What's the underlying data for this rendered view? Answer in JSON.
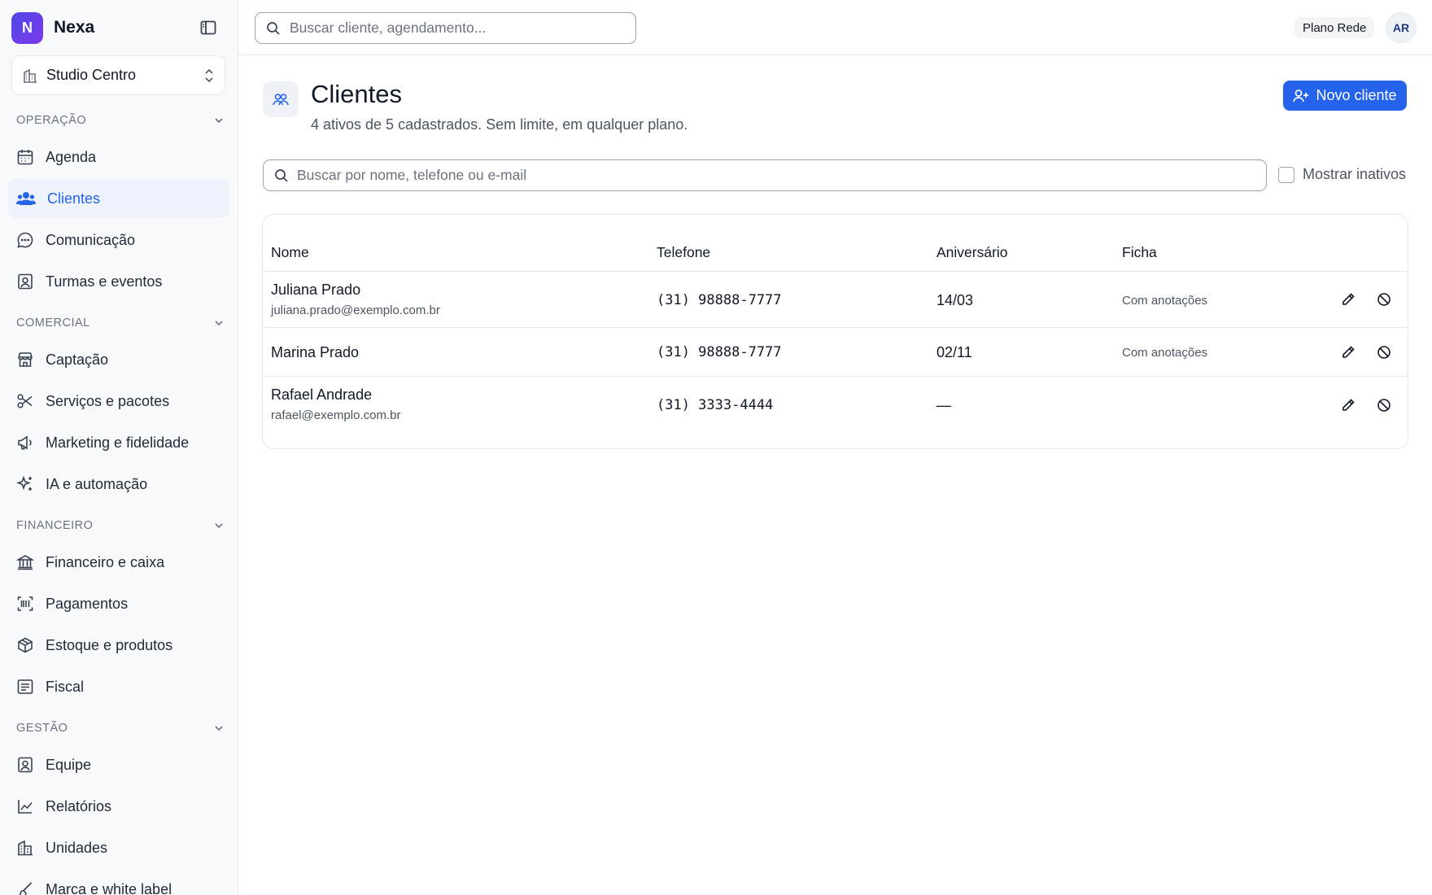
{
  "brand": {
    "logo_letter": "N",
    "name": "Nexa"
  },
  "unit_selector": {
    "label": "Studio Centro"
  },
  "sections": {
    "operacao": "OPERAÇÃO",
    "comercial": "COMERCIAL",
    "financeiro": "FINANCEIRO",
    "gestao": "GESTÃO"
  },
  "nav": {
    "agenda": "Agenda",
    "clientes": "Clientes",
    "comunicacao": "Comunicação",
    "turmas": "Turmas e eventos",
    "captacao": "Captação",
    "servicos": "Serviços e pacotes",
    "marketing": "Marketing e fidelidade",
    "ia": "IA e automação",
    "financeiro": "Financeiro e caixa",
    "pagamentos": "Pagamentos",
    "estoque": "Estoque e produtos",
    "fiscal": "Fiscal",
    "equipe": "Equipe",
    "relatorios": "Relatórios",
    "unidades": "Unidades",
    "marca": "Marca e white label"
  },
  "topbar": {
    "search_placeholder": "Buscar cliente, agendamento...",
    "plan": "Plano Rede",
    "avatar_initials": "AR"
  },
  "page": {
    "title": "Clientes",
    "subtitle": "4 ativos de 5 cadastrados. Sem limite, em qualquer plano.",
    "new_button": "Novo cliente",
    "filter_placeholder": "Buscar por nome, telefone ou e-mail",
    "show_inactive_label": "Mostrar inativos"
  },
  "table": {
    "headers": {
      "name": "Nome",
      "phone": "Telefone",
      "birthday": "Aniversário",
      "record": "Ficha"
    },
    "rows": [
      {
        "name": "Juliana Prado",
        "email": "juliana.prado@exemplo.com.br",
        "phone": "(31) 98888-7777",
        "birthday": "14/03",
        "record": "Com anotações"
      },
      {
        "name": "Marina Prado",
        "email": "",
        "phone": "(31) 98888-7777",
        "birthday": "02/11",
        "record": "Com anotações"
      },
      {
        "name": "Rafael Andrade",
        "email": "rafael@exemplo.com.br",
        "phone": "(31) 3333-4444",
        "birthday": "—",
        "record": ""
      }
    ]
  },
  "colors": {
    "accent": "#2563eb",
    "brand_gradient_start": "#4f46e5",
    "brand_gradient_end": "#7c3aed"
  }
}
